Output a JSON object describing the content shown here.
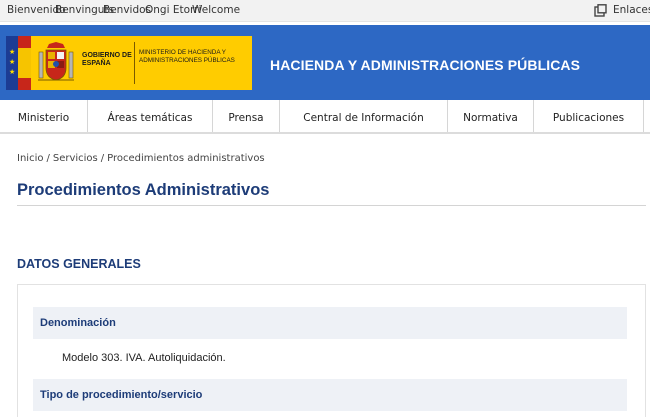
{
  "language_bar": {
    "languages": [
      "Bienvenido",
      "Benvinguts",
      "Benvidos",
      "Ongi Etorri",
      "Welcome"
    ],
    "enlaces_label": "Enlaces c"
  },
  "header": {
    "logo_gobierno": "GOBIERNO DE ESPAÑA",
    "logo_ministerio": "MINISTERIO DE HACIENDA Y ADMINISTRACIONES PÚBLICAS",
    "site_title": "HACIENDA Y ADMINISTRACIONES PÚBLICAS"
  },
  "nav": {
    "items": [
      "Ministerio",
      "Áreas temáticas",
      "Prensa",
      "Central de Información",
      "Normativa",
      "Publicaciones"
    ]
  },
  "breadcrumb": {
    "items": [
      "Inicio",
      "Servicios",
      "Procedimientos administrativos"
    ],
    "separator": "/"
  },
  "page": {
    "title": "Procedimientos Administrativos",
    "section_title": "DATOS GENERALES"
  },
  "datos_generales": {
    "fields": [
      {
        "label": "Denominación",
        "value": "Modelo 303. IVA. Autoliquidación."
      },
      {
        "label": "Tipo de procedimiento/servicio",
        "value": ""
      }
    ]
  },
  "colors": {
    "header_blue": "#2d68c4",
    "title_navy": "#1d3c78",
    "logo_yellow": "#ffcc00"
  }
}
